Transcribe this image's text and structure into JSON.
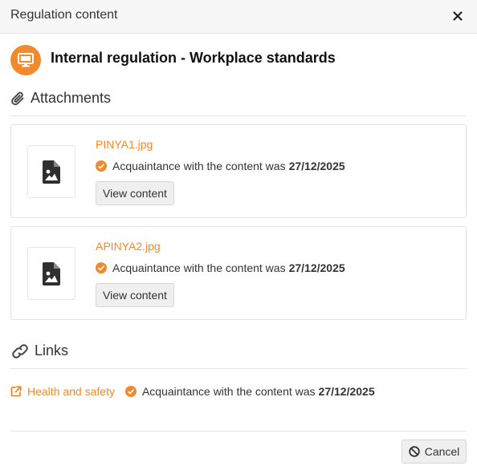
{
  "dialog": {
    "title": "Regulation content",
    "close_icon": "close-icon"
  },
  "regulation": {
    "icon": "monitor-icon",
    "title": "Internal regulation - Workplace standards"
  },
  "attachments": {
    "icon": "paperclip-icon",
    "heading": "Attachments",
    "items": [
      {
        "file_name": "PINYA1.jpg",
        "file_icon": "image-file-icon",
        "ack_text": "Acquaintance with the content was",
        "ack_date": "27/12/2025",
        "button_label": "View content"
      },
      {
        "file_name": "APINYA2.jpg",
        "file_icon": "image-file-icon",
        "ack_text": "Acquaintance with the content was",
        "ack_date": "27/12/2025",
        "button_label": "View content"
      }
    ]
  },
  "links": {
    "icon": "link-icon",
    "heading": "Links",
    "items": [
      {
        "label": "Health and safety",
        "icon": "external-link-icon",
        "ack_text": "Acquaintance with the content was",
        "ack_date": "27/12/2025"
      }
    ]
  },
  "footer": {
    "cancel_label": "Cancel",
    "cancel_icon": "ban-icon"
  },
  "colors": {
    "accent": "#f08a2c",
    "text": "#333333",
    "header_bg": "#f7f7f7"
  }
}
